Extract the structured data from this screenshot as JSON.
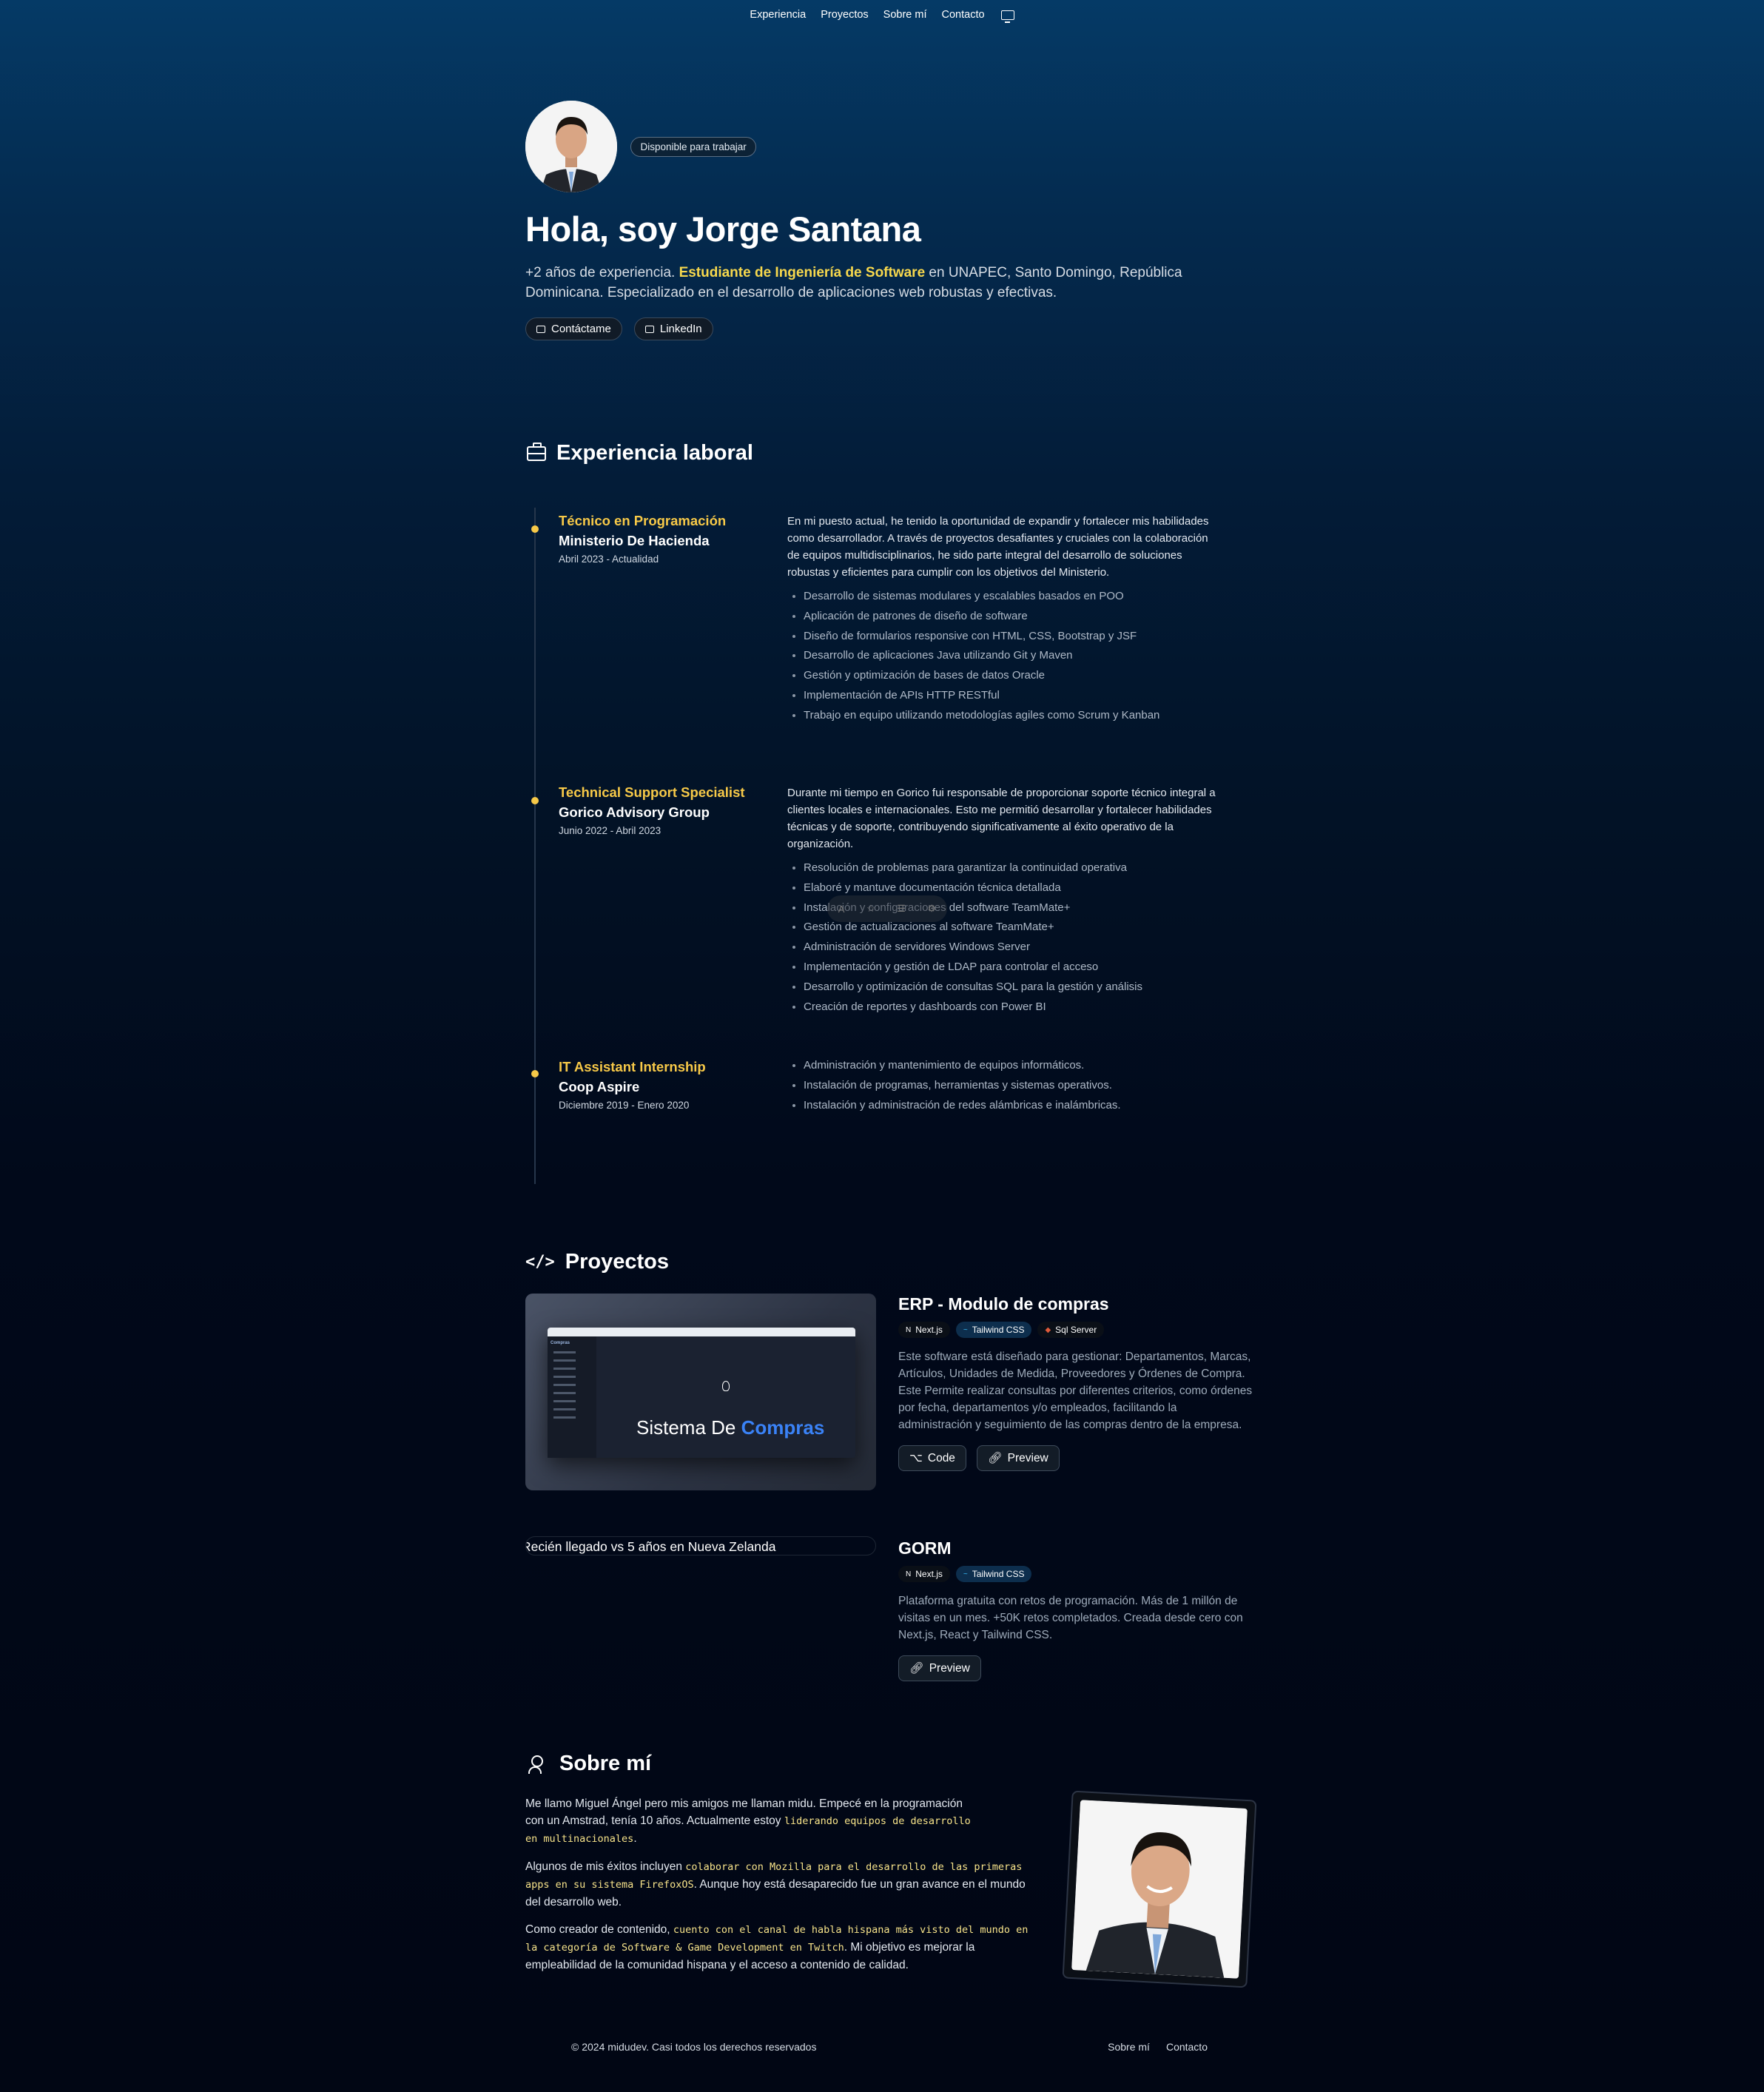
{
  "nav": {
    "items": [
      "Experiencia",
      "Proyectos",
      "Sobre mí",
      "Contacto"
    ],
    "theme_icon": "monitor-icon"
  },
  "hero": {
    "badge": "Disponible para trabajar",
    "title": "Hola, soy Jorge Santana",
    "lead_pre": "+2 años de experiencia. ",
    "lead_hl": "Estudiante de Ingeniería de Software",
    "lead_post": " en UNAPEC, Santo Domingo, República Dominicana. Especializado en el desarrollo de aplicaciones web robustas y efectivas.",
    "contact_button": "Contáctame",
    "linkedin_button": "LinkedIn"
  },
  "experience": {
    "title": "Experiencia laboral",
    "jobs": [
      {
        "role": "Técnico en Programación",
        "company": "Ministerio De Hacienda",
        "date": "Abril 2023 - Actualidad",
        "description": "En mi puesto actual, he tenido la oportunidad de expandir y fortalecer mis habilidades como desarrollador. A través de proyectos desafiantes y cruciales con la colaboración de equipos multidisciplinarios, he sido parte integral del desarrollo de soluciones robustas y eficientes para cumplir con los objetivos del Ministerio.",
        "bullets": [
          "Desarrollo de sistemas modulares y escalables basados en POO",
          "Aplicación de patrones de diseño de software",
          "Diseño de formularios responsive con HTML, CSS, Bootstrap y JSF",
          "Desarrollo de aplicaciones Java utilizando Git y Maven",
          "Gestión y optimización de bases de datos Oracle",
          "Implementación de APIs HTTP RESTful",
          "Trabajo en equipo utilizando metodologías agiles como Scrum y Kanban"
        ]
      },
      {
        "role": "Technical Support Specialist",
        "company": "Gorico Advisory Group",
        "date": "Junio 2022 - Abril 2023",
        "description": "Durante mi tiempo en Gorico fui responsable de proporcionar soporte técnico integral a clientes locales e internacionales. Esto me permitió desarrollar y fortalecer habilidades técnicas y de soporte, contribuyendo significativamente al éxito operativo de la organización.",
        "bullets": [
          "Resolución de problemas para garantizar la continuidad operativa",
          "Elaboré y mantuve documentación técnica detallada",
          "Instalación y configuraciones del software TeamMate+",
          "Gestión de actualizaciones al software TeamMate+",
          "Administración de servidores Windows Server",
          "Implementación y gestión de LDAP para controlar el acceso",
          "Desarrollo y optimización de consultas SQL para la gestión y análisis",
          "Creación de reportes y dashboards con Power BI"
        ]
      },
      {
        "role": "IT Assistant Internship",
        "company": "Coop Aspire",
        "date": "Diciembre 2019 - Enero 2020",
        "description": "",
        "bullets": [
          "Administración y mantenimiento de equipos informáticos.",
          "Instalación de programas, herramientas y sistemas operativos.",
          "Instalación y administración de redes alámbricas e inalámbricas."
        ]
      }
    ]
  },
  "projects": {
    "title": "Proyectos",
    "items": [
      {
        "title": "ERP - Modulo de compras",
        "tags": [
          "Next.js",
          "Tailwind CSS",
          "Sql Server"
        ],
        "description": "Este software está diseñado para gestionar: Departamentos, Marcas, Artículos, Unidades de Medida, Proveedores y Órdenes de Compra. Este Permite realizar consultas por diferentes criterios, como órdenes por fecha, departamentos y/o empleados, facilitando la administración y seguimiento de las compras dentro de la empresa.",
        "code_button": "Code",
        "preview_button": "Preview",
        "image_title_pre": "Sistema De ",
        "image_title_hl": "Compras"
      },
      {
        "title": "GORM",
        "tags": [
          "Next.js",
          "Tailwind CSS"
        ],
        "description": "Plataforma gratuita con retos de programación. Más de 1 millón de visitas en un mes. +50K retos completados. Creada desde cero con Next.js, React y Tailwind CSS.",
        "preview_button": "Preview",
        "video_caption": "Recién llegado vs 5 años en Nueva Zelanda"
      }
    ]
  },
  "about": {
    "title": "Sobre mí",
    "p1_pre": "Me llamo Miguel Ángel pero mis amigos me llaman midu. Empecé en la programación con un Amstrad, tenía 10 años. Actualmente estoy ",
    "p1_hl": "liderando equipos de desarrollo en multinacionales",
    "p1_post": ".",
    "p2_pre": "Algunos de mis éxitos incluyen ",
    "p2_hl": "colaborar con Mozilla para el desarrollo de las primeras apps en su sistema FirefoxOS",
    "p2_post": ". Aunque hoy está desaparecido fue un gran avance en el mundo del desarrollo web.",
    "p3_pre": "Como creador de contenido, ",
    "p3_hl": "cuento con el canal de habla hispana más visto del mundo en la categoría de Software & Game Development en Twitch",
    "p3_post": ". Mi objetivo es mejorar la empleabilidad de la comunidad hispana y el acceso a contenido de calidad."
  },
  "footer": {
    "copyright": "© 2024 midudev. Casi todos los derechos reservados",
    "links": [
      "Sobre mí",
      "Contacto"
    ]
  },
  "colors": {
    "accent": "#f7c948",
    "highlight": "#f7d84d",
    "link_blue": "#3a82f6"
  }
}
